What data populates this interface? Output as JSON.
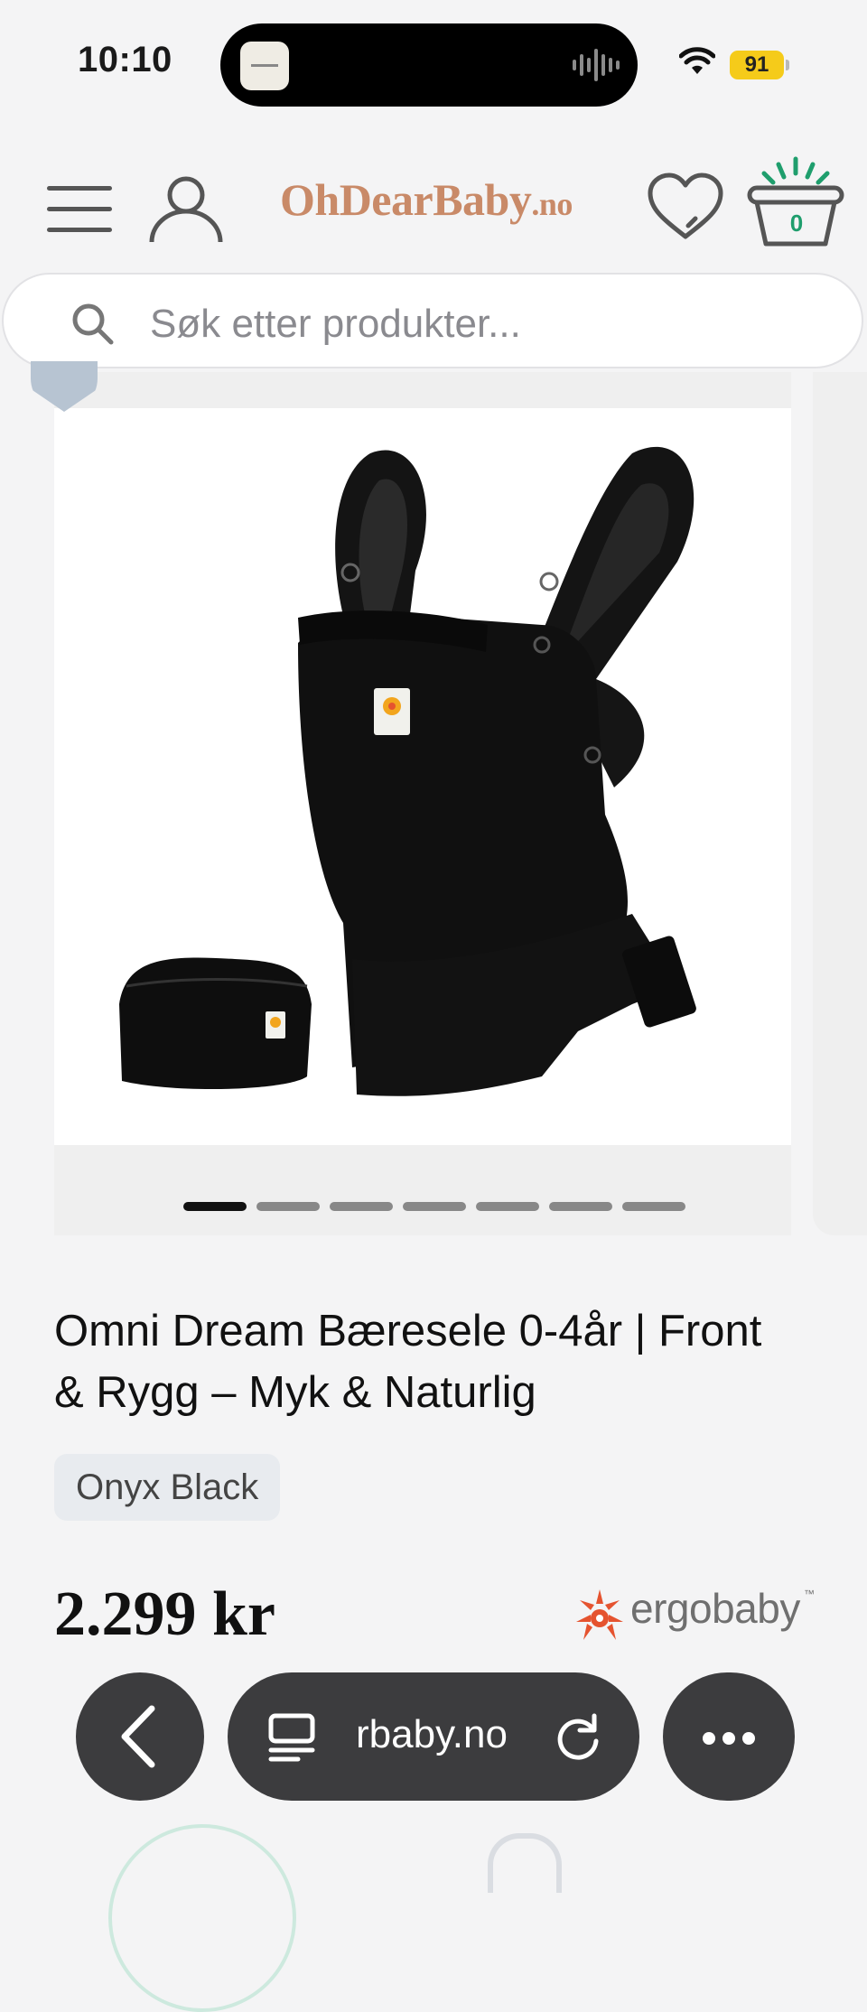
{
  "status_bar": {
    "time": "10:10",
    "battery": "91",
    "icons": [
      "wifi-icon",
      "battery-icon",
      "audio-wave-icon"
    ]
  },
  "header": {
    "logo_main": "OhDearBaby",
    "logo_tld": ".no",
    "cart_count": "0",
    "icons": [
      "menu-icon",
      "account-icon",
      "heart-icon",
      "basket-icon"
    ]
  },
  "search": {
    "placeholder": "Søk etter produkter..."
  },
  "gallery": {
    "slide_count": 7,
    "active_slide": 1
  },
  "product": {
    "title": "Omni Dream Bæresele 0-4år | Front & Rygg – Myk & Naturlig",
    "variant": "Onyx Black",
    "price": "2.299 kr",
    "brand": "ergobaby"
  },
  "browser": {
    "url": "rbaby.no",
    "icons": [
      "back-icon",
      "reader-icon",
      "reload-icon",
      "more-icon"
    ]
  },
  "colors": {
    "logo": "#c98a68",
    "cart_count": "#1f9e6d",
    "battery": "#f5cb1a",
    "brand_orange": "#e5532f"
  }
}
